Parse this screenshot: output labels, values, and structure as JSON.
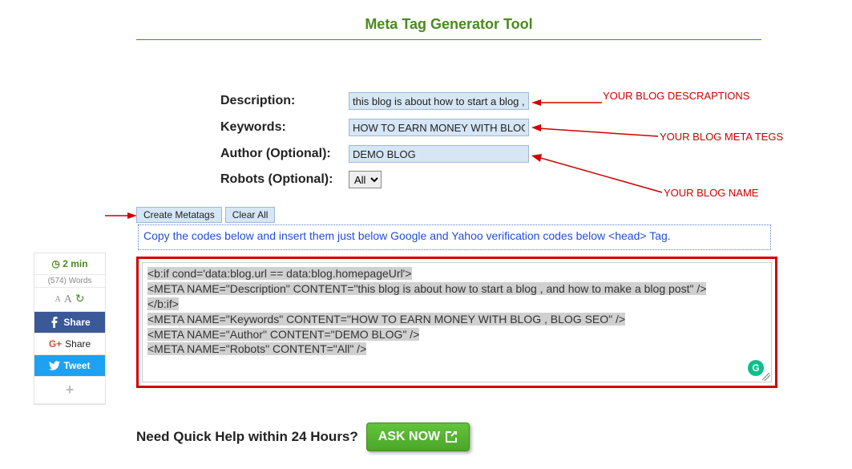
{
  "title": "Meta Tag Generator Tool",
  "form": {
    "description": {
      "label": "Description:",
      "value": "this blog is about how to start a blog , and how to m"
    },
    "keywords": {
      "label": "Keywords:",
      "value": "HOW TO EARN MONEY WITH BLOG , BLOG SE"
    },
    "author": {
      "label": "Author (Optional):",
      "value": "DEMO BLOG"
    },
    "robots": {
      "label": "Robots (Optional):",
      "value": "All"
    }
  },
  "annotations": {
    "desc": "YOUR BLOG DESCRAPTIONS",
    "tags": "YOUR BLOG META TEGS",
    "name": "YOUR BLOG NAME"
  },
  "buttons": {
    "create": "Create Metatags",
    "clear": "Clear All"
  },
  "instruction": "Copy the codes below and insert them just below Google and Yahoo verification codes below <head> Tag.",
  "output_lines": [
    "<b:if cond='data:blog.url == data:blog.homepageUrl'>",
    "<META NAME=\"Description\" CONTENT=\"this blog is about how to start a blog , and how to make a blog post\" />",
    "</b:if>",
    "<META NAME=\"Keywords\" CONTENT=\"HOW TO EARN MONEY WITH BLOG , BLOG SEO\" />",
    "<META NAME=\"Author\" CONTENT=\"DEMO BLOG\" />",
    "<META NAME=\"Robots\" CONTENT=\"All\" />"
  ],
  "help": {
    "text": "Need Quick Help within 24 Hours?",
    "button": "ASK NOW"
  },
  "sidebar": {
    "time": "2 min",
    "words": "(574) Words",
    "share": "Share",
    "share2": "Share",
    "tweet": "Tweet",
    "g_badge": "G"
  }
}
